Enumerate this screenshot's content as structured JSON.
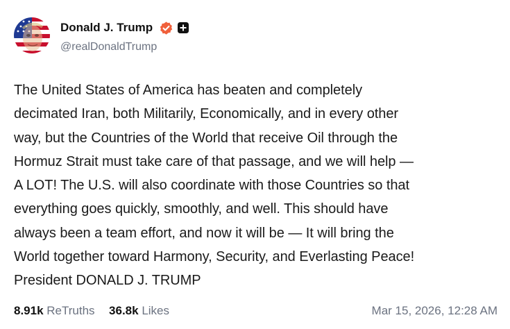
{
  "post": {
    "author": {
      "display_name": "Donald J. Trump",
      "handle": "@realDonaldTrump",
      "verified_icon": "verified-badge-icon",
      "plus_icon": "plus-square-icon"
    },
    "body_lines": [
      "The United States of America has beaten and completely",
      "decimated Iran, both Militarily, Economically, and in every other",
      "way, but the Countries of the World that receive Oil through the",
      "Hormuz Strait must take care of that passage, and we will help —",
      "A LOT! The U.S. will also coordinate with those Countries so that",
      "everything goes quickly, smoothly, and well. This should have",
      "always been a team effort, and now it will be — It will bring the",
      "World together toward Harmony, Security, and Everlasting Peace!",
      "President DONALD J. TRUMP"
    ],
    "stats": {
      "retruths_count": "8.91k",
      "retruths_label": "ReTruths",
      "likes_count": "36.8k",
      "likes_label": "Likes"
    },
    "timestamp": "Mar 15, 2026, 12:28 AM"
  },
  "colors": {
    "verified": "#f0603b",
    "secondary_text": "#6b7280",
    "primary_text": "#1a1a1a"
  }
}
